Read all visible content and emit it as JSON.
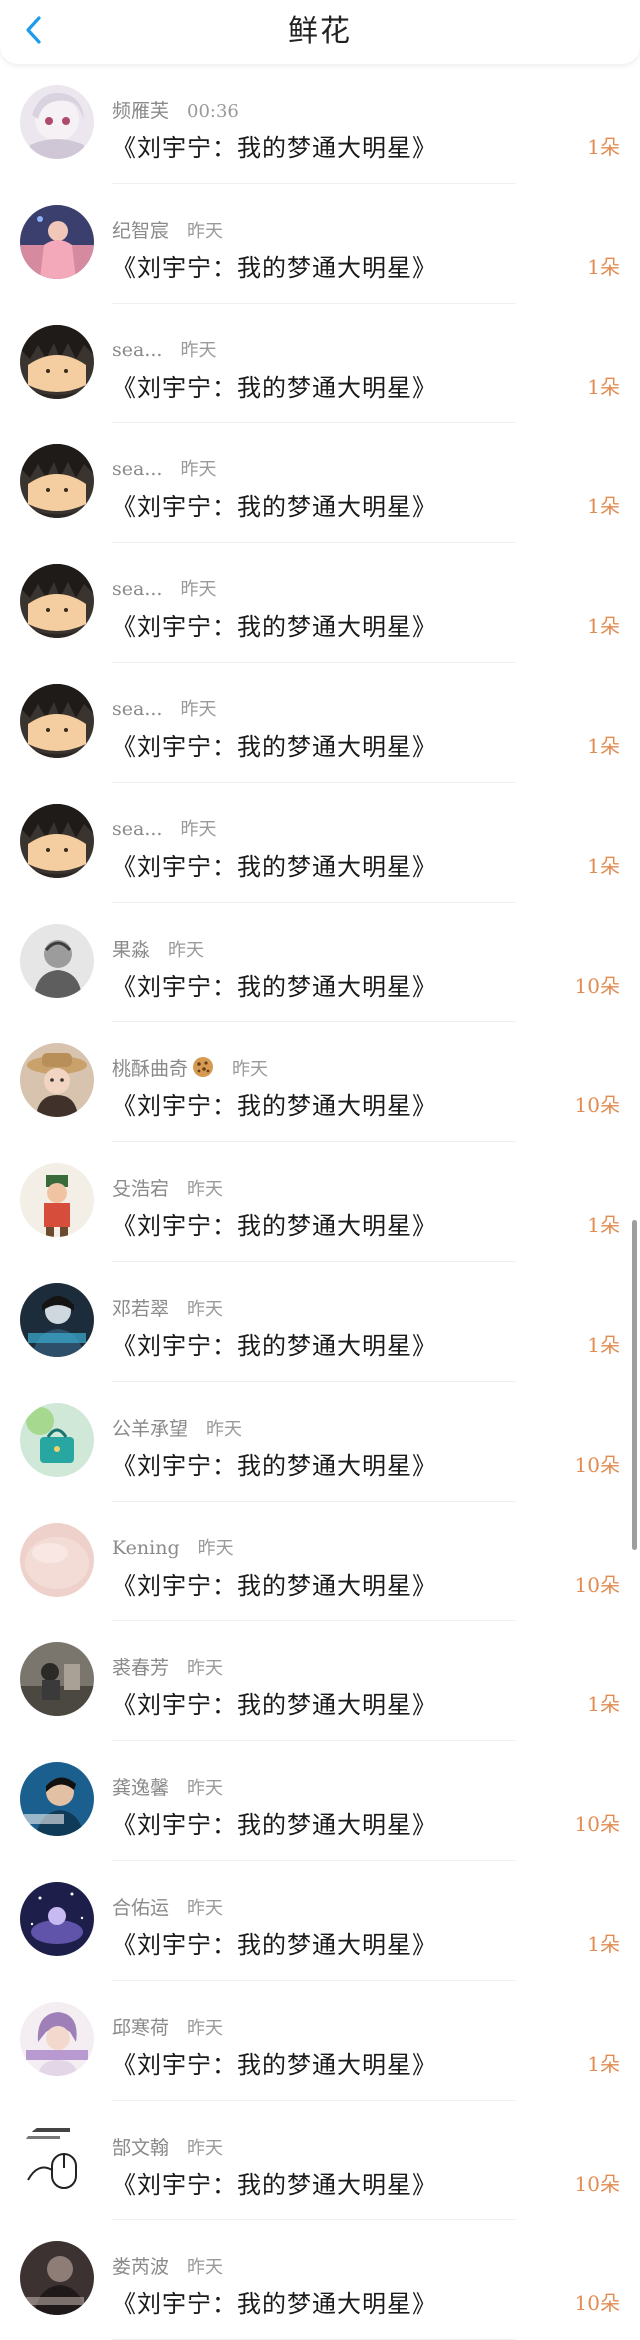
{
  "header": {
    "title": "鲜花",
    "back_icon": "chevron-left-icon",
    "accent_color": "#1e9bea"
  },
  "items": [
    {
      "name": "频雁芙",
      "time": "00:36",
      "book": "《刘宇宁：我的梦通大明星》",
      "count": "1朵",
      "avatar": "anime-girl"
    },
    {
      "name": "纪智宸",
      "time": "昨天",
      "book": "《刘宇宁：我的梦通大明星》",
      "count": "1朵",
      "avatar": "pink-figure"
    },
    {
      "name": "sea...",
      "time": "昨天",
      "book": "《刘宇宁：我的梦通大明星》",
      "count": "1朵",
      "avatar": "cartoon-face"
    },
    {
      "name": "sea...",
      "time": "昨天",
      "book": "《刘宇宁：我的梦通大明星》",
      "count": "1朵",
      "avatar": "cartoon-face"
    },
    {
      "name": "sea...",
      "time": "昨天",
      "book": "《刘宇宁：我的梦通大明星》",
      "count": "1朵",
      "avatar": "cartoon-face"
    },
    {
      "name": "sea...",
      "time": "昨天",
      "book": "《刘宇宁：我的梦通大明星》",
      "count": "1朵",
      "avatar": "cartoon-face"
    },
    {
      "name": "sea...",
      "time": "昨天",
      "book": "《刘宇宁：我的梦通大明星》",
      "count": "1朵",
      "avatar": "cartoon-face"
    },
    {
      "name": "果淼",
      "time": "昨天",
      "book": "《刘宇宁：我的梦通大明星》",
      "count": "10朵",
      "avatar": "bw-portrait"
    },
    {
      "name": "桃酥曲奇",
      "time": "昨天",
      "book": "《刘宇宁：我的梦通大明星》",
      "count": "10朵",
      "avatar": "girl-hat",
      "emoji": "cookie"
    },
    {
      "name": "殳浩宕",
      "time": "昨天",
      "book": "《刘宇宁：我的梦通大明星》",
      "count": "1朵",
      "avatar": "cartoon-man"
    },
    {
      "name": "邓若翠",
      "time": "昨天",
      "book": "《刘宇宁：我的梦通大明星》",
      "count": "1朵",
      "avatar": "dark-portrait"
    },
    {
      "name": "公羊承望",
      "time": "昨天",
      "book": "《刘宇宁：我的梦通大明星》",
      "count": "10朵",
      "avatar": "teal-bag"
    },
    {
      "name": "Kening",
      "time": "昨天",
      "book": "《刘宇宁：我的梦通大明星》",
      "count": "10朵",
      "avatar": "pink-skin"
    },
    {
      "name": "裘春芳",
      "time": "昨天",
      "book": "《刘宇宁：我的梦通大明星》",
      "count": "1朵",
      "avatar": "street-photo"
    },
    {
      "name": "龚逸馨",
      "time": "昨天",
      "book": "《刘宇宁：我的梦通大明星》",
      "count": "10朵",
      "avatar": "blue-boy"
    },
    {
      "name": "合佑运",
      "time": "昨天",
      "book": "《刘宇宁：我的梦通大明星》",
      "count": "1朵",
      "avatar": "galaxy"
    },
    {
      "name": "邱寒荷",
      "time": "昨天",
      "book": "《刘宇宁：我的梦通大明星》",
      "count": "1朵",
      "avatar": "purple-hair"
    },
    {
      "name": "郜文翰",
      "time": "昨天",
      "book": "《刘宇宁：我的梦通大明星》",
      "count": "10朵",
      "avatar": "mouse-sketch"
    },
    {
      "name": "娄芮波",
      "time": "昨天",
      "book": "《刘宇宁：我的梦通大明星》",
      "count": "10朵",
      "avatar": "dark-ink"
    }
  ],
  "colors": {
    "count_text": "#e28c52",
    "name_text": "#8a8a8a",
    "title_text": "#1a1a1a"
  }
}
